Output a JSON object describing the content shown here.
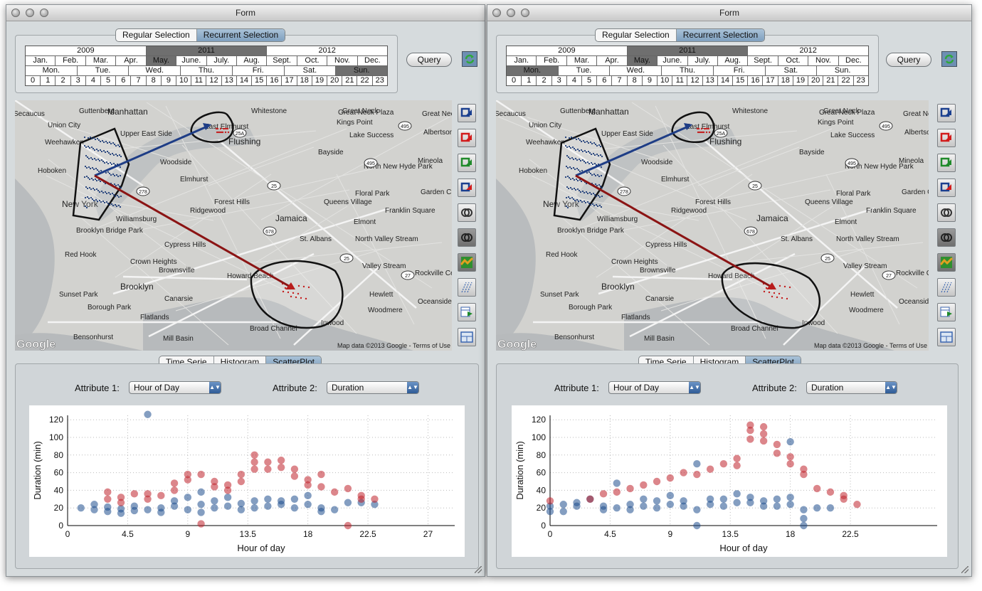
{
  "window_title": "Form",
  "selection_tabs": [
    "Regular Selection",
    "Recurrent Selection"
  ],
  "calendar": {
    "years": [
      "2009",
      "2011",
      "2012"
    ],
    "months": [
      "Jan.",
      "Feb.",
      "Mar.",
      "Apr.",
      "May.",
      "June.",
      "July.",
      "Aug.",
      "Sept.",
      "Oct.",
      "Nov.",
      "Dec."
    ],
    "weekdays": [
      "Mon.",
      "Tue.",
      "Wed.",
      "Thu.",
      "Fri.",
      "Sat.",
      "Sun."
    ],
    "hours": [
      "0",
      "1",
      "2",
      "3",
      "4",
      "5",
      "6",
      "7",
      "8",
      "9",
      "10",
      "11",
      "12",
      "13",
      "14",
      "15",
      "16",
      "17",
      "18",
      "19",
      "20",
      "21",
      "22",
      "23"
    ]
  },
  "query_label": "Query",
  "analysis_tabs": [
    "Time Serie",
    "Histogram",
    "ScatterPlot"
  ],
  "attribute1_label": "Attribute 1:",
  "attribute1_value": "Hour of Day",
  "attribute2_label": "Attribute 2:",
  "attribute2_value": "Duration",
  "map_labels": {
    "places": [
      "Secaucus",
      "Guttenberg",
      "Manhattan",
      "Union City",
      "Weehawken",
      "Upper East Side",
      "Whitestone",
      "East Elmhurst",
      "Flushing",
      "Great Neck Plaza",
      "Great Neck",
      "Kings Point",
      "Great Neck Estates",
      "Albertson",
      "Hoboken",
      "Woodside",
      "Elmhurst",
      "Bayside",
      "Lake Success",
      "North New Hyde Park",
      "Mineola",
      "New York",
      "Forest Hills",
      "Queens Village",
      "Floral Park",
      "Garden City",
      "Ridgewood",
      "Jamaica",
      "Elmont",
      "Franklin Square",
      "Williamsburg",
      "Brooklyn Bridge Park",
      "Cypress Hills",
      "St. Albans",
      "North Valley Stream",
      "Red Hook",
      "Crown Heights",
      "Brownsville",
      "Valley Stream",
      "Rockville Centre",
      "Brooklyn",
      "Howard Beach",
      "Sunset Park",
      "Borough Park",
      "Canarsie",
      "Hewlett",
      "Woodmere",
      "Oceanside",
      "Flatlands",
      "Bensonhurst",
      "Mill Basin",
      "Broad Channel",
      "Inwood"
    ],
    "highway_shields": [
      "495",
      "25A",
      "278",
      "25",
      "495",
      "25",
      "678",
      "27"
    ],
    "google_logo": "Google",
    "attribution": "Map data ©2013 Google - Terms of Use"
  },
  "scatter_axis_labels": {
    "x": "Hour of day",
    "y": "Duration (min)"
  },
  "left_view": {
    "selected_year": "2011",
    "selected_month": "May.",
    "selected_weekday": "Sun.",
    "active_tool": "Regular Selection",
    "zone_to_zone": [
      "Manhattan",
      "East Elmhurst",
      "Howard Beach"
    ]
  },
  "right_view": {
    "selected_year": "2011",
    "selected_month": "May.",
    "selected_weekday": "Mon.",
    "active_tool": "Recurrent Selection"
  },
  "colors": {
    "series_a": "#c0232b",
    "series_b": "#1f4f8e"
  },
  "chart_data": [
    {
      "type": "scatter",
      "xlabel": "Hour of day",
      "ylabel": "Duration (min)",
      "xlim": [
        0,
        29
      ],
      "ylim": [
        0,
        125
      ],
      "xticks": [
        "0",
        "4.5",
        "9",
        "13.5",
        "18",
        "22.5",
        "27"
      ],
      "yticks": [
        "0",
        "20",
        "40",
        "60",
        "80",
        "100",
        "120"
      ],
      "grid": true,
      "series": [
        {
          "color": "#1f4f8e",
          "points": [
            [
              1,
              20
            ],
            [
              2,
              18
            ],
            [
              2,
              24
            ],
            [
              3,
              21
            ],
            [
              3,
              16
            ],
            [
              4,
              19
            ],
            [
              4,
              14
            ],
            [
              5,
              17
            ],
            [
              5,
              22
            ],
            [
              6,
              18
            ],
            [
              6,
              126
            ],
            [
              7,
              20
            ],
            [
              7,
              15
            ],
            [
              8,
              22
            ],
            [
              8,
              28
            ],
            [
              9,
              18
            ],
            [
              9,
              32
            ],
            [
              10,
              24
            ],
            [
              10,
              38
            ],
            [
              10,
              15
            ],
            [
              11,
              20
            ],
            [
              11,
              28
            ],
            [
              12,
              22
            ],
            [
              12,
              32
            ],
            [
              13,
              25
            ],
            [
              13,
              18
            ],
            [
              14,
              28
            ],
            [
              14,
              20
            ],
            [
              15,
              30
            ],
            [
              15,
              22
            ],
            [
              16,
              28
            ],
            [
              16,
              24
            ],
            [
              17,
              30
            ],
            [
              17,
              20
            ],
            [
              18,
              24
            ],
            [
              18,
              34
            ],
            [
              19,
              20
            ],
            [
              19,
              16
            ],
            [
              20,
              18
            ],
            [
              21,
              26
            ],
            [
              22,
              26
            ],
            [
              23,
              24
            ]
          ]
        },
        {
          "color": "#c0232b",
          "points": [
            [
              3,
              38
            ],
            [
              3,
              30
            ],
            [
              4,
              32
            ],
            [
              4,
              26
            ],
            [
              5,
              36
            ],
            [
              6,
              36
            ],
            [
              6,
              30
            ],
            [
              7,
              34
            ],
            [
              8,
              48
            ],
            [
              8,
              40
            ],
            [
              9,
              58
            ],
            [
              9,
              52
            ],
            [
              10,
              58
            ],
            [
              10,
              2
            ],
            [
              11,
              44
            ],
            [
              11,
              50
            ],
            [
              12,
              46
            ],
            [
              12,
              40
            ],
            [
              13,
              58
            ],
            [
              13,
              50
            ],
            [
              14,
              80
            ],
            [
              14,
              72
            ],
            [
              14,
              64
            ],
            [
              15,
              72
            ],
            [
              15,
              64
            ],
            [
              16,
              74
            ],
            [
              16,
              66
            ],
            [
              17,
              64
            ],
            [
              17,
              56
            ],
            [
              18,
              52
            ],
            [
              18,
              46
            ],
            [
              19,
              58
            ],
            [
              19,
              44
            ],
            [
              20,
              38
            ],
            [
              21,
              42
            ],
            [
              21,
              0
            ],
            [
              22,
              34
            ],
            [
              22,
              30
            ],
            [
              23,
              30
            ]
          ]
        }
      ]
    },
    {
      "type": "scatter",
      "xlabel": "Hour of day",
      "ylabel": "Duration (min)",
      "xlim": [
        0,
        29
      ],
      "ylim": [
        0,
        125
      ],
      "xticks": [
        "0",
        "4.5",
        "9",
        "13.5",
        "18",
        "22.5"
      ],
      "yticks": [
        "0",
        "20",
        "40",
        "60",
        "80",
        "100",
        "120"
      ],
      "grid": true,
      "series": [
        {
          "color": "#1f4f8e",
          "points": [
            [
              0,
              22
            ],
            [
              0,
              16
            ],
            [
              1,
              24
            ],
            [
              1,
              16
            ],
            [
              2,
              22
            ],
            [
              2,
              26
            ],
            [
              3,
              30
            ],
            [
              4,
              18
            ],
            [
              4,
              22
            ],
            [
              5,
              48
            ],
            [
              5,
              20
            ],
            [
              6,
              18
            ],
            [
              6,
              24
            ],
            [
              7,
              22
            ],
            [
              7,
              30
            ],
            [
              8,
              20
            ],
            [
              8,
              28
            ],
            [
              9,
              24
            ],
            [
              9,
              34
            ],
            [
              10,
              22
            ],
            [
              10,
              28
            ],
            [
              11,
              70
            ],
            [
              11,
              18
            ],
            [
              11,
              0
            ],
            [
              12,
              24
            ],
            [
              12,
              30
            ],
            [
              13,
              22
            ],
            [
              13,
              30
            ],
            [
              14,
              26
            ],
            [
              14,
              36
            ],
            [
              15,
              26
            ],
            [
              15,
              32
            ],
            [
              16,
              28
            ],
            [
              16,
              22
            ],
            [
              17,
              30
            ],
            [
              17,
              22
            ],
            [
              18,
              95
            ],
            [
              18,
              24
            ],
            [
              18,
              32
            ],
            [
              19,
              18
            ],
            [
              19,
              8
            ],
            [
              19,
              0
            ],
            [
              20,
              20
            ],
            [
              21,
              20
            ]
          ]
        },
        {
          "color": "#c0232b",
          "points": [
            [
              0,
              28
            ],
            [
              3,
              30
            ],
            [
              4,
              36
            ],
            [
              5,
              38
            ],
            [
              6,
              42
            ],
            [
              7,
              46
            ],
            [
              8,
              50
            ],
            [
              9,
              54
            ],
            [
              10,
              60
            ],
            [
              11,
              58
            ],
            [
              12,
              64
            ],
            [
              13,
              70
            ],
            [
              14,
              76
            ],
            [
              14,
              68
            ],
            [
              15,
              114
            ],
            [
              15,
              108
            ],
            [
              15,
              98
            ],
            [
              16,
              112
            ],
            [
              16,
              104
            ],
            [
              16,
              96
            ],
            [
              17,
              92
            ],
            [
              17,
              82
            ],
            [
              18,
              78
            ],
            [
              18,
              70
            ],
            [
              19,
              64
            ],
            [
              19,
              58
            ],
            [
              20,
              42
            ],
            [
              21,
              38
            ],
            [
              22,
              34
            ],
            [
              22,
              30
            ],
            [
              23,
              24
            ]
          ]
        }
      ]
    }
  ]
}
